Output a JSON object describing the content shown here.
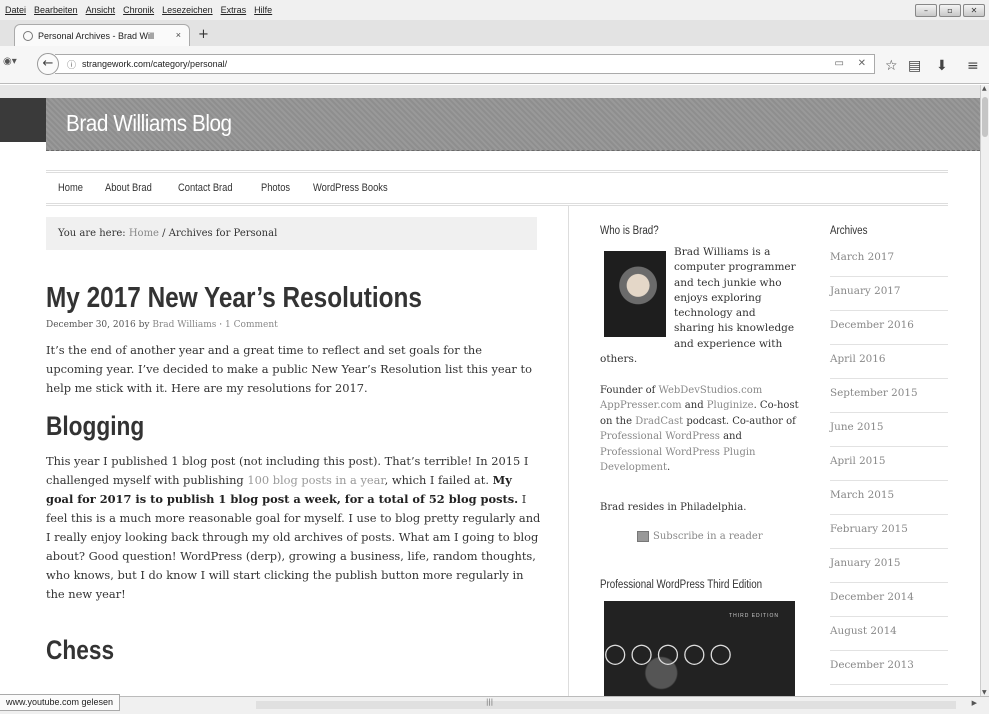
{
  "menu": [
    "Datei",
    "Bearbeiten",
    "Ansicht",
    "Chronik",
    "Lesezeichen",
    "Extras",
    "Hilfe"
  ],
  "tab": {
    "title": "Personal Archives - Brad Will",
    "close": "×",
    "new": "+"
  },
  "url": "strangework.com/category/personal/",
  "site_title": "Brad Williams Blog",
  "nav": [
    "Home",
    "About Brad",
    "Contact Brad",
    "Photos",
    "WordPress Books"
  ],
  "breadcrumb": {
    "prefix": "You are here:",
    "home": "Home",
    "sep": "/",
    "current": "Archives for Personal"
  },
  "post": {
    "title": "My 2017 New Year’s Resolutions",
    "date": "December 30, 2016",
    "by": "by",
    "author": "Brad Williams",
    "dot": "·",
    "comments": "1 Comment",
    "intro": "It’s the end of another year and a great time to reflect and set goals for the upcoming year. I’ve decided to make a public New Year’s Resolution list this year to help me stick with it. Here are my resolutions for 2017.",
    "h_blogging": "Blogging",
    "blog_p1": "This year I published 1 blog post (not including this post). That’s terrible! In 2015 I challenged myself with publishing ",
    "blog_link": "100 blog posts in a year",
    "blog_p2": ", which I failed at. ",
    "blog_bold": "My goal for 2017 is to publish 1 blog post a week, for a total of 52 blog posts.",
    "blog_p3": " I feel this is a much more reasonable goal for myself. I use to blog pretty regularly and I really enjoy looking back through my old archives of posts. What am I going to blog about? Good question! WordPress (derp), growing a business, life, random thoughts, who knows, but I do know I will start clicking the publish button more regularly in the new year!",
    "h_chess": "Chess"
  },
  "sidebar": {
    "who_title": "Who is Brad?",
    "bio": "Brad Williams is a computer programmer and tech junkie who enjoys exploring technology and sharing his knowledge and experience with others.",
    "f1": "Founder of ",
    "webdev": "WebDevStudios.com",
    "apppresser": "AppPresser.com",
    "and1": " and ",
    "pluginize": "Pluginize",
    "f2": ". Co-host on the ",
    "dradcast": "DradCast",
    "f3": " podcast. Co-author of ",
    "prowp": "Professional WordPress",
    "and2": " and ",
    "prowpplugin": "Professional WordPress Plugin Development",
    "f4": ".",
    "resides": "Brad resides in Philadelphia.",
    "subscribe": "Subscribe in a reader",
    "book_title": "Professional WordPress Third Edition",
    "book_edition": "THIRD EDITION"
  },
  "archives": {
    "title": "Archives",
    "items": [
      "March 2017",
      "January 2017",
      "December 2016",
      "April 2016",
      "September 2015",
      "June 2015",
      "April 2015",
      "March 2015",
      "February 2015",
      "January 2015",
      "December 2014",
      "August 2014",
      "December 2013"
    ]
  },
  "status": "www.youtube.com gelesen"
}
